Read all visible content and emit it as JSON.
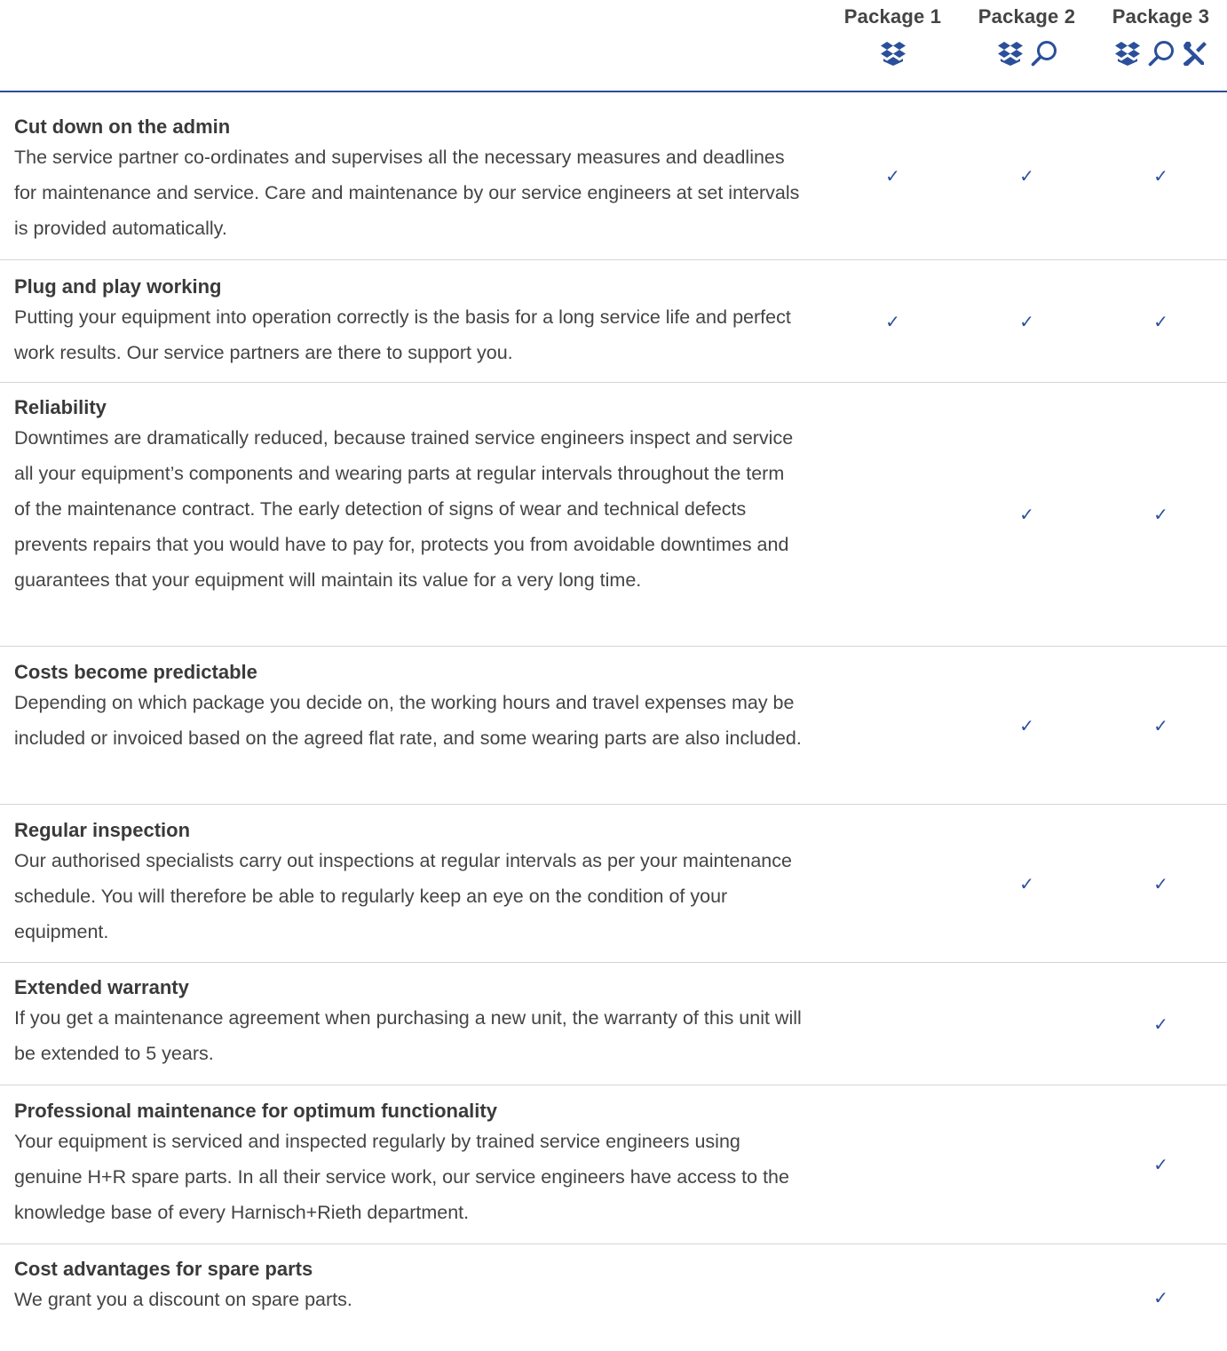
{
  "colors": {
    "accent": "#2b4f9a",
    "text": "#3a3a3a",
    "divider": "#d5d5d5"
  },
  "packages": [
    {
      "label": "Package 1",
      "icons": [
        "box-icon"
      ]
    },
    {
      "label": "Package 2",
      "icons": [
        "box-icon",
        "magnifier-icon"
      ]
    },
    {
      "label": "Package 3",
      "icons": [
        "box-icon",
        "magnifier-icon",
        "tools-icon"
      ]
    }
  ],
  "check_glyph": "✓",
  "rows": [
    {
      "title": "Cut down on the admin",
      "description": "The service partner co-ordinates and supervises all the necessary measures and deadlines for maintenance and service. Care and maintenance by our service engineers at set intervals is provided automatically.",
      "included": [
        true,
        true,
        true
      ]
    },
    {
      "title": "Plug and play working",
      "description": "Putting your equipment into operation correctly is the basis for a long service life and perfect work results. Our service partners are there to support you.",
      "included": [
        true,
        true,
        true
      ]
    },
    {
      "title": "Reliability",
      "description": "Downtimes are dramatically reduced, because trained service engineers inspect and service all your equipment’s components and wearing parts at regular intervals throughout the term of the maintenance contract. The early detection of signs of wear and technical defects prevents repairs that you would have to pay for, protects you from avoidable downtimes and guarantees that your equipment will maintain its value for a very long time.",
      "included": [
        false,
        true,
        true
      ]
    },
    {
      "title": "Costs become predictable",
      "description": "Depending on which package you decide on, the working hours and travel expenses may be included or invoiced based on the agreed flat rate, and some wearing parts are also included.",
      "included": [
        false,
        true,
        true
      ]
    },
    {
      "title": "Regular inspection",
      "description": "Our authorised specialists carry out inspections at regular intervals as per your maintenance schedule. You will therefore be able to regularly keep an eye on the condition of your equipment.",
      "included": [
        false,
        true,
        true
      ]
    },
    {
      "title": "Extended warranty",
      "description": "If you get a maintenance agreement when purchasing a new unit, the warranty of this unit will be extended to 5 years.",
      "included": [
        false,
        false,
        true
      ]
    },
    {
      "title": "Professional maintenance for optimum functionality",
      "description": "Your equipment is serviced and inspected regularly by trained service engineers using genuine H+R spare parts. In all their service work, our service engineers have access to the knowledge base of every Harnisch+Rieth department.",
      "included": [
        false,
        false,
        true
      ]
    },
    {
      "title": "Cost advantages for spare parts",
      "description": "We grant you a discount on spare parts.",
      "included": [
        false,
        false,
        true
      ]
    }
  ]
}
